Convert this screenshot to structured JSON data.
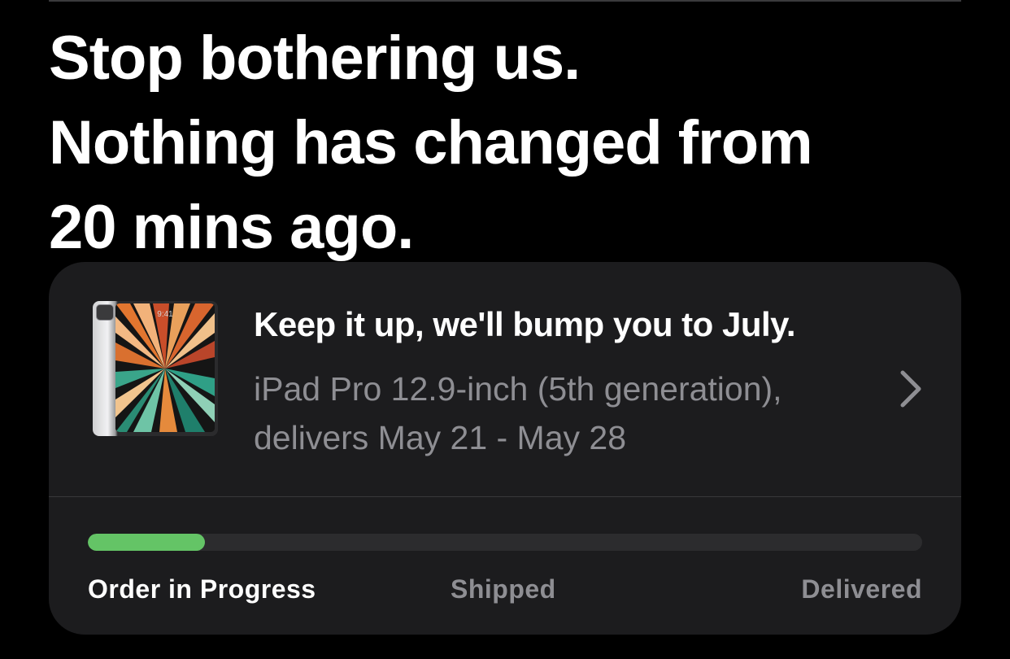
{
  "headline": {
    "line1": "Stop bothering us.",
    "line2": "Nothing has changed from",
    "line3": "20 mins ago."
  },
  "order": {
    "title": "Keep it up, we'll bump you to July.",
    "description_line1": "iPad Pro 12.9-inch (5th generation),",
    "description_line2": "delivers May 21 - May 28",
    "thumbnail_time": "9:41",
    "thumbnail_icon": "ipad-pro-product-image",
    "chevron_icon": "chevron-right-icon",
    "progress_fraction": 0.14,
    "stages": [
      "Order in Progress",
      "Shipped",
      "Delivered"
    ],
    "active_stage_index": 0
  },
  "colors": {
    "background": "#000000",
    "card": "#1c1c1e",
    "progress_active": "#64c466",
    "progress_track": "#2c2c2e",
    "secondary_text": "#8e8e93"
  }
}
